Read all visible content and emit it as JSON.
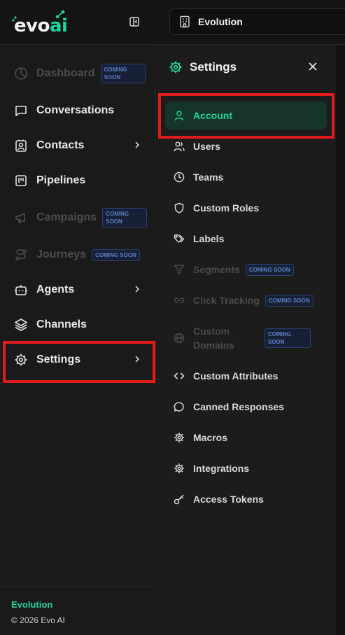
{
  "brand": {
    "logo_text_a": "evo",
    "logo_text_b": "ai"
  },
  "header": {
    "workspace_name": "Evolution"
  },
  "sidebar": {
    "items": [
      {
        "label": "Dashboard",
        "badge": "COMING SOON"
      },
      {
        "label": "Conversations"
      },
      {
        "label": "Contacts"
      },
      {
        "label": "Pipelines"
      },
      {
        "label": "Campaigns",
        "badge": "COMING SOON"
      },
      {
        "label": "Journeys",
        "badge": "COMING SOON"
      },
      {
        "label": "Agents"
      },
      {
        "label": "Channels"
      },
      {
        "label": "Settings"
      }
    ],
    "footer": {
      "name": "Evolution",
      "copyright": "© 2026 Evo AI"
    }
  },
  "settings_panel": {
    "title": "Settings",
    "items": [
      {
        "label": "Account"
      },
      {
        "label": "Users"
      },
      {
        "label": "Teams"
      },
      {
        "label": "Custom Roles"
      },
      {
        "label": "Labels"
      },
      {
        "label": "Segments",
        "badge": "COMING SOON"
      },
      {
        "label": "Click Tracking",
        "badge": "COMING SOON"
      },
      {
        "label_line1": "Custom",
        "label_line2": "Domains",
        "badge": "COMING SOON"
      },
      {
        "label": "Custom Attributes"
      },
      {
        "label": "Canned Responses"
      },
      {
        "label": "Macros"
      },
      {
        "label": "Integrations"
      },
      {
        "label": "Access Tokens"
      }
    ]
  },
  "colors": {
    "accent": "#22d3a0",
    "highlight": "#e01b1b",
    "badge_text": "#5b7fc4"
  }
}
